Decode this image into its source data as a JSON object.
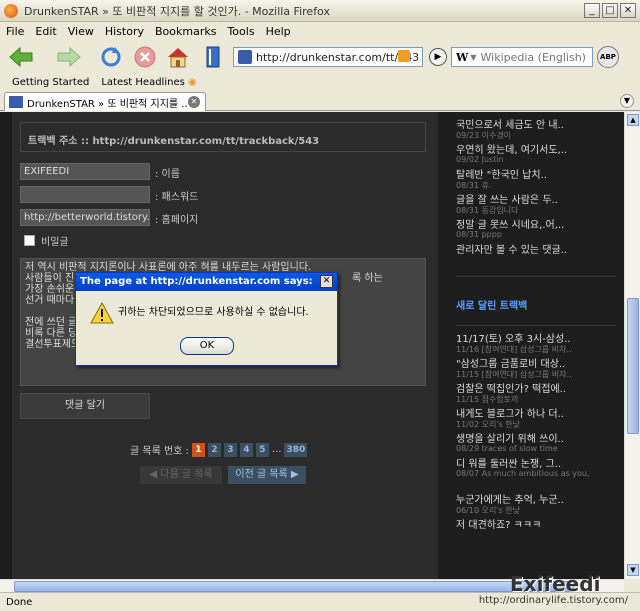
{
  "window": {
    "title": "DrunkenSTAR » 또 비판적 지지를 할 것인가. - Mozilla Firefox"
  },
  "menu": [
    "File",
    "Edit",
    "View",
    "History",
    "Bookmarks",
    "Tools",
    "Help"
  ],
  "toolbar": {
    "url": "http://drunkenstar.com/tt/543",
    "search_placeholder": "Wikipedia (English)",
    "search_engine": "W"
  },
  "bookmarks": [
    "Getting Started",
    "Latest Headlines"
  ],
  "tab": {
    "label": "DrunkenSTAR » 또 비판적 지지를 ..."
  },
  "page": {
    "trackback": "트랙백 주소 :: http://drunkenstar.com/tt/trackback/543",
    "name_value": "EXIFEEDI",
    "name_label": ": 이름",
    "password_value": "",
    "password_label": ": 패스워드",
    "homepage_value": "http://betterworld.tistory.com",
    "homepage_label": ": 홈페이지",
    "secret_label": "비밀글",
    "comment_lines": [
      "저 역시 비판적 지지론이나 사표론에 아주 혀를 내두르는 사람입니다.",
      "사람들이 진",
      "가장 손쉬운",
      "선거 때마다",
      "",
      "전에 쓰던 글",
      "비록 다른 당",
      "결선투표제도"
    ],
    "comment_partial_right": "록 하는",
    "submit_label": "댓글 달기",
    "pager_label": "글 목록 번호 :",
    "pages": [
      "1",
      "2",
      "3",
      "4",
      "5"
    ],
    "pages_ellipsis": "...",
    "last_page": "380",
    "prev_label": "◀ 다음 글 목록",
    "next_label": "이전 글 목록 ▶"
  },
  "sidebar": {
    "top_items": [
      {
        "title": "국민으로서 세금도 안 내..",
        "meta": "09/23 이수경이"
      },
      {
        "title": "우연히 왔는데, 여기서도,..",
        "meta": "09/02 Justin"
      },
      {
        "title": "탈레반 \"한국인 납치..",
        "meta": "08/31 휴."
      },
      {
        "title": "글을 잘 쓰는 사람은 두..",
        "meta": "08/31 동감입니다"
      },
      {
        "title": "정말 글 못쓰 시네요,.어,..",
        "meta": "08/31 pppp"
      },
      {
        "title": "관리자만 볼 수 있는 댓글..",
        "meta": ""
      }
    ],
    "trackback_heading": "새로 달린 트랙백",
    "trackbacks": [
      {
        "title": "11/17(토) 오후 3시-삼성..",
        "meta": "11/16 [참여연대] 삼성그룹 비자.."
      },
      {
        "title": "\"삼성그룹 금품로비 대상..",
        "meta": "11/15 [참여연대] 삼성그룹 비자.."
      },
      {
        "title": "검찰은 떡집인가? 떡접에..",
        "meta": "11/15 점수함토끼"
      },
      {
        "title": "내게도 블로그가 하나 더..",
        "meta": "11/02 오리's 한낮"
      },
      {
        "title": "생명을 살리기 위해 쓰이..",
        "meta": "08/29 traces of slow time"
      },
      {
        "title": "디 워를 둘러싼 논쟁, 그..",
        "meta": "08/07 As much ambitious as you,"
      },
      {
        "title": "누군가에게는 추억, 누군..",
        "meta": "06/10 오리's 한낮"
      },
      {
        "title": "저 대견하죠? ㅋㅋㅋ",
        "meta": ""
      }
    ]
  },
  "dialog": {
    "title": "The page at http://drunkenstar.com says:",
    "message": "귀하는 차단되었으므로 사용하실 수 없습니다.",
    "ok_label": "OK"
  },
  "status": {
    "text": "Done",
    "url": "http://ordinarylife.tistory.com/"
  },
  "watermark": "Exifeedi"
}
